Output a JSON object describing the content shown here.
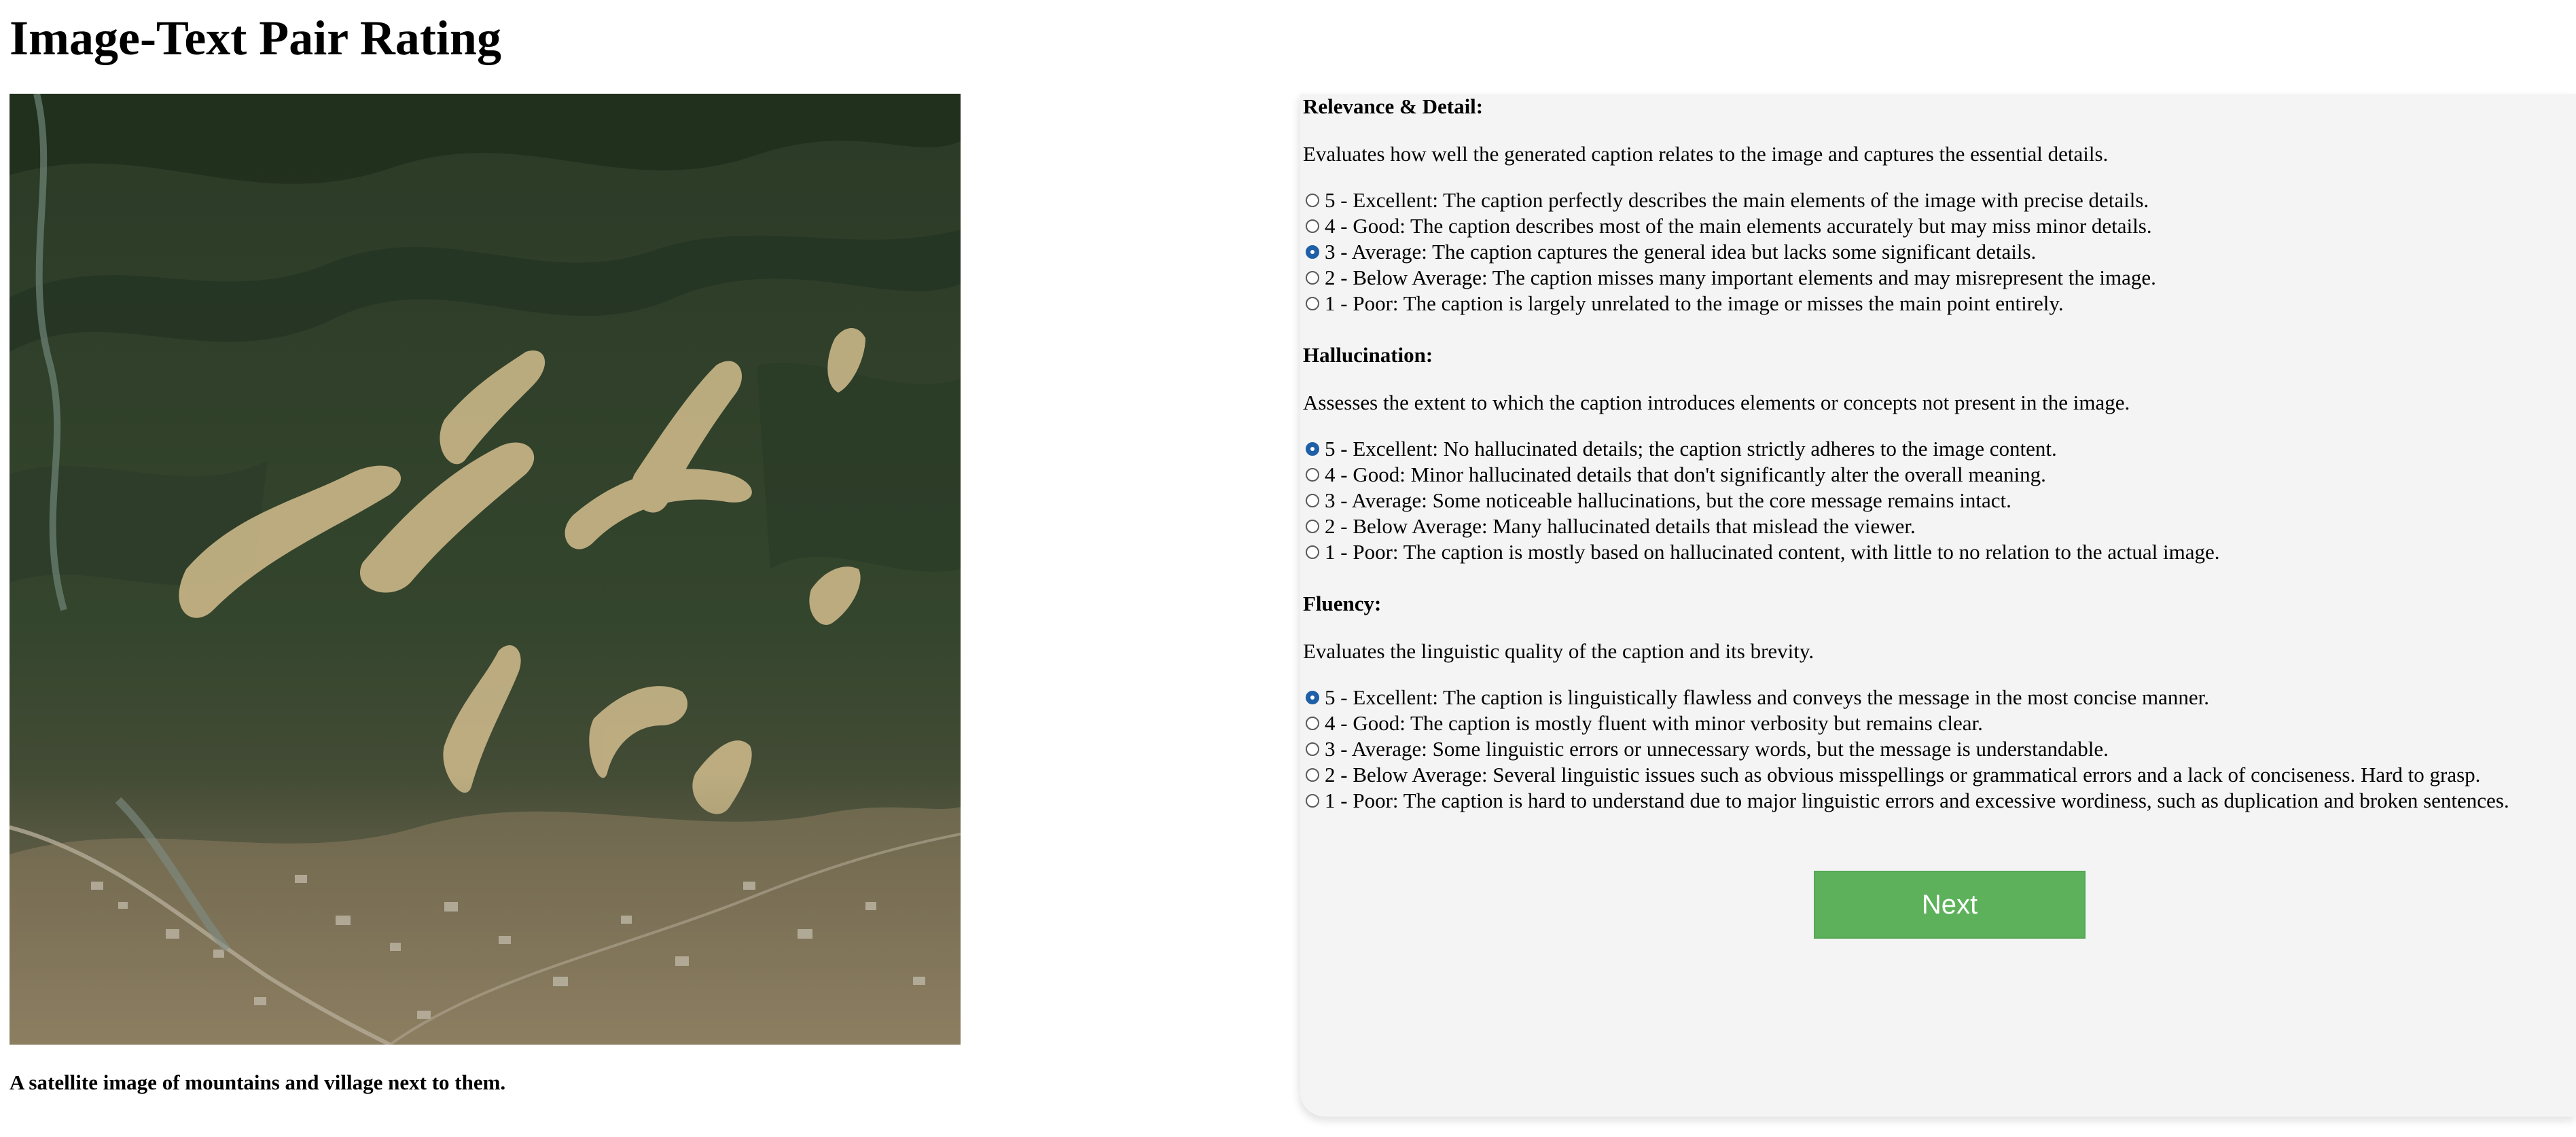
{
  "page": {
    "title": "Image-Text Pair Rating",
    "caption": "A satellite image of mountains and village next to them."
  },
  "criteria": [
    {
      "title": "Relevance & Detail:",
      "description": "Evaluates how well the generated caption relates to the image and captures the essential details.",
      "selected": "3",
      "options": [
        {
          "value": "5",
          "label": "5 - Excellent: The caption perfectly describes the main elements of the image with precise details."
        },
        {
          "value": "4",
          "label": "4 - Good: The caption describes most of the main elements accurately but may miss minor details."
        },
        {
          "value": "3",
          "label": "3 - Average: The caption captures the general idea but lacks some significant details."
        },
        {
          "value": "2",
          "label": "2 - Below Average: The caption misses many important elements and may misrepresent the image."
        },
        {
          "value": "1",
          "label": "1 - Poor: The caption is largely unrelated to the image or misses the main point entirely."
        }
      ]
    },
    {
      "title": "Hallucination:",
      "description": "Assesses the extent to which the caption introduces elements or concepts not present in the image.",
      "selected": "5",
      "options": [
        {
          "value": "5",
          "label": "5 - Excellent: No hallucinated details; the caption strictly adheres to the image content."
        },
        {
          "value": "4",
          "label": "4 - Good: Minor hallucinated details that don't significantly alter the overall meaning."
        },
        {
          "value": "3",
          "label": "3 - Average: Some noticeable hallucinations, but the core message remains intact."
        },
        {
          "value": "2",
          "label": "2 - Below Average: Many hallucinated details that mislead the viewer."
        },
        {
          "value": "1",
          "label": "1 - Poor: The caption is mostly based on hallucinated content, with little to no relation to the actual image."
        }
      ]
    },
    {
      "title": "Fluency:",
      "description": "Evaluates the linguistic quality of the caption and its brevity.",
      "selected": "5",
      "options": [
        {
          "value": "5",
          "label": "5 - Excellent: The caption is linguistically flawless and conveys the message in the most concise manner."
        },
        {
          "value": "4",
          "label": "4 - Good: The caption is mostly fluent with minor verbosity but remains clear."
        },
        {
          "value": "3",
          "label": "3 - Average: Some linguistic errors or unnecessary words, but the message is understandable."
        },
        {
          "value": "2",
          "label": "2 - Below Average: Several linguistic issues such as obvious misspellings or grammatical errors and a lack of conciseness. Hard to grasp."
        },
        {
          "value": "1",
          "label": "1 - Poor: The caption is hard to understand due to major linguistic errors and excessive wordiness, such as duplication and broken sentences."
        }
      ]
    }
  ],
  "next_button": {
    "label": "Next"
  },
  "colors": {
    "panel_bg": "#f4f4f4",
    "accent": "#1f5fa8",
    "button_bg": "#5cb15a"
  }
}
